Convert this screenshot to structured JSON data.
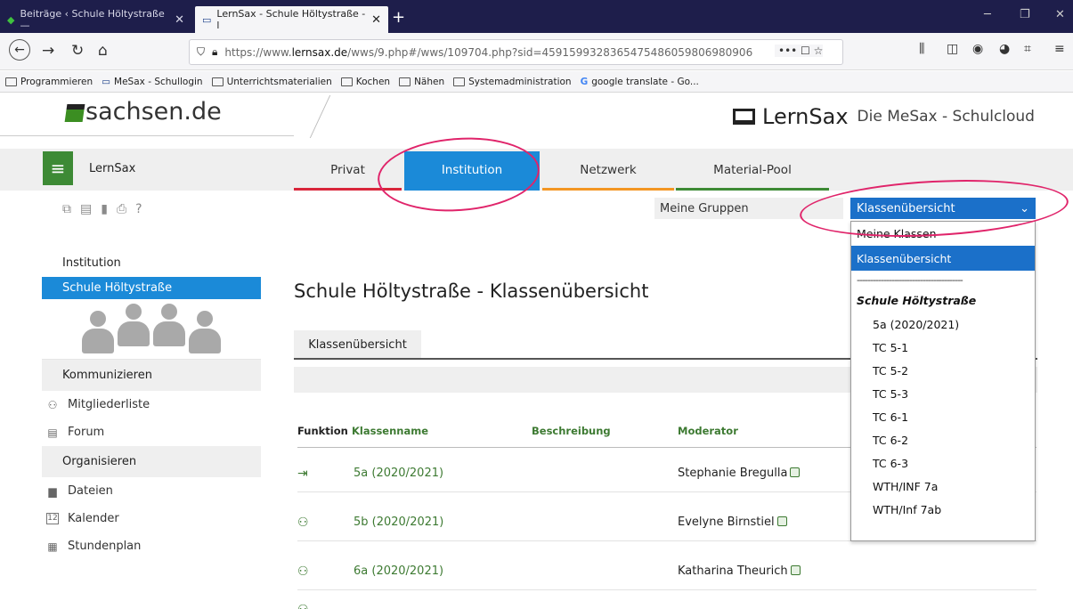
{
  "browser": {
    "tabs": [
      {
        "label": "Beiträge ‹ Schule Höltystraße —",
        "close": "✕"
      },
      {
        "label": "LernSax - Schule Höltystraße - l",
        "close": "✕"
      }
    ],
    "new_tab": "+",
    "window_controls": [
      "─",
      "❐",
      "✕"
    ],
    "url_gray_prefix": "https://www.",
    "url_host": "lernsax.de",
    "url_rest": "/wws/9.php#/wws/109704.php?sid=4591599328365475486059806980906",
    "url_actions": "••• ☐ ☆",
    "bookmarks": [
      "Programmieren",
      "MeSax - Schullogin",
      "Unterrichtsmaterialien",
      "Kochen",
      "Nähen",
      "Systemadministration",
      "google translate - Go..."
    ]
  },
  "site": {
    "sachsen_logo": "sachsen.de",
    "lernsax_name": "LernSax",
    "lernsax_sub": "Die MeSax - Schulcloud"
  },
  "mainnav": {
    "label": "LernSax",
    "tabs": [
      "Privat",
      "Institution",
      "Netzwerk",
      "Material-Pool"
    ]
  },
  "selects": {
    "gruppen": "Meine Gruppen",
    "klassen": "Klassenübersicht"
  },
  "dropdown": {
    "items": [
      "Meine Klassen",
      "Klassenübersicht",
      "----------------------------------------",
      "Schule Höltystraße",
      "5a (2020/2021)",
      "TC 5-1",
      "TC 5-2",
      "TC 5-3",
      "TC 6-1",
      "TC 6-2",
      "TC 6-3",
      "WTH/INF 7a",
      "WTH/Inf 7ab"
    ]
  },
  "sidebar": {
    "head": "Institution",
    "active": "Schule Höltystraße",
    "sec1": "Kommunizieren",
    "items1": [
      "Mitgliederliste",
      "Forum"
    ],
    "sec2": "Organisieren",
    "items2": [
      "Dateien",
      "Kalender",
      "Stundenplan"
    ]
  },
  "main": {
    "title": "Schule Höltystraße - Klassenübersicht",
    "tab": "Klassenübersicht",
    "headers": [
      "Funktion",
      "Klassenname",
      "Beschreibung",
      "Moderator"
    ],
    "rows": [
      {
        "name": "5a (2020/2021)",
        "moderator": "Stephanie Bregulla"
      },
      {
        "name": "5b (2020/2021)",
        "moderator": "Evelyne Birnstiel"
      },
      {
        "name": "6a (2020/2021)",
        "moderator": "Katharina Theurich"
      }
    ]
  }
}
